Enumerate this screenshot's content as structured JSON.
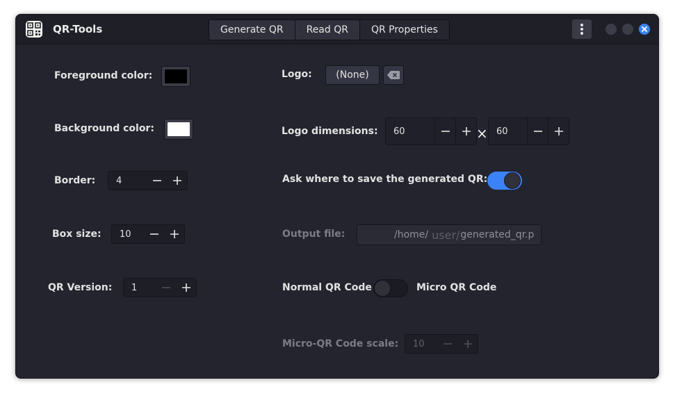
{
  "window": {
    "title": "QR-Tools",
    "tabs": [
      {
        "label": "Generate QR",
        "active": false
      },
      {
        "label": "Read QR",
        "active": false
      },
      {
        "label": "QR Properties",
        "active": true
      }
    ]
  },
  "left": {
    "foreground_label": "Foreground color:",
    "foreground_color": "#000000",
    "background_label": "Background color:",
    "background_color": "#ffffff",
    "border_label": "Border:",
    "border_value": "4",
    "box_size_label": "Box size:",
    "box_size_value": "10",
    "qr_version_label": "QR Version:",
    "qr_version_value": "1"
  },
  "right": {
    "logo_label": "Logo:",
    "logo_button": "(None)",
    "logo_dimensions_label": "Logo dimensions:",
    "logo_width": "60",
    "logo_height": "60",
    "times_sign": "×",
    "ask_save_label": "Ask where to save the generated QR:",
    "ask_save_enabled": true,
    "output_file_label": "Output file:",
    "output_path_start": "/home/",
    "output_path_user": "user/",
    "output_path_end": "generated_qr.p",
    "normal_qr_label": "Normal QR Code",
    "micro_qr_label": "Micro QR Code",
    "micro_mode_enabled": false,
    "micro_scale_label": "Micro-QR Code scale:",
    "micro_scale_value": "10"
  },
  "icons": [
    "qr-code-icon",
    "kebab-menu-icon",
    "close-icon",
    "backspace-clear-icon",
    "minus-icon",
    "plus-icon"
  ],
  "colors": {
    "accent": "#3b82f6",
    "window_bg": "#23242e",
    "titlebar_bg": "#1e1f27"
  }
}
